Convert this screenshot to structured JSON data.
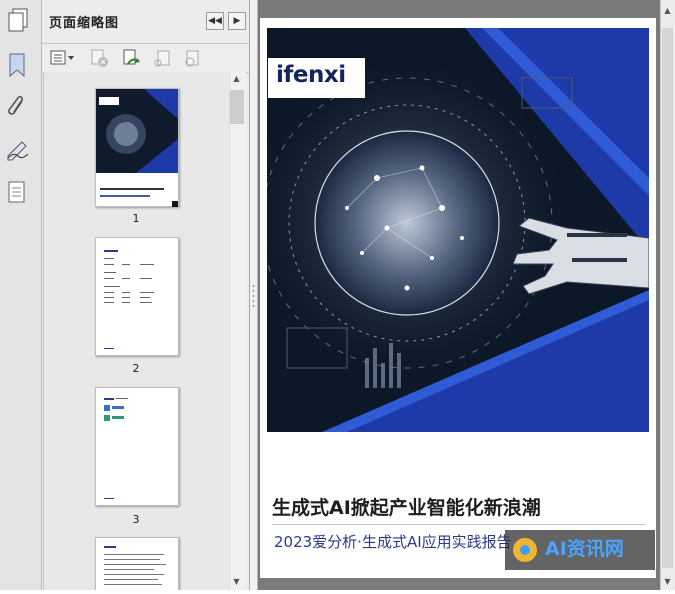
{
  "panel": {
    "title": "页面缩略图",
    "prev_label": "◀◀",
    "next_label": "▶"
  },
  "thumbnails": [
    {
      "page": "1",
      "cover_title": "生成式AI掀起产业智能化新浪潮",
      "cover_sub": "2023爱分析·生成式AI应用实践报告"
    },
    {
      "page": "2"
    },
    {
      "page": "3"
    }
  ],
  "document": {
    "logo": "ifenxi",
    "title": "生成式AI掀起产业智能化新浪潮",
    "subtitle": "2023爱分析·生成式AI应用实践报告",
    "watermark": "AI资讯网"
  },
  "colors": {
    "accent_navy": "#14245e",
    "accent_blue": "#2b3b8f",
    "stripe_blue": "#1d3aa8"
  },
  "icons": [
    "pages-icon",
    "bookmark-icon",
    "attachment-icon",
    "signature-icon",
    "layers-icon",
    "options-icon",
    "delete-page-icon",
    "rotate-page-icon",
    "cut-icon",
    "print-icon"
  ]
}
